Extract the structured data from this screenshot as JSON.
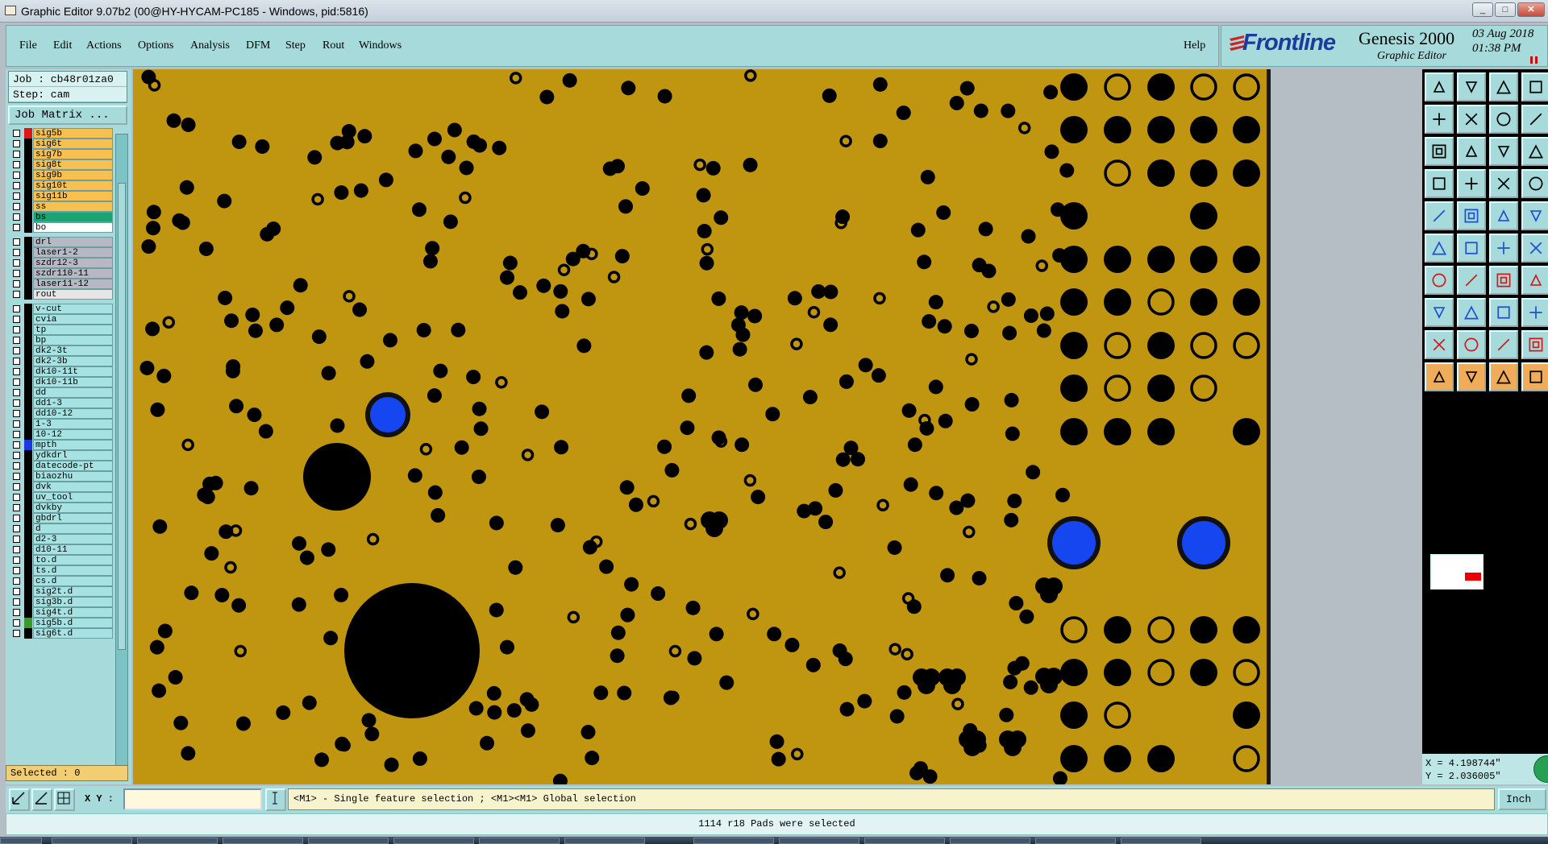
{
  "window": {
    "title": "Graphic Editor 9.07b2 (00@HY-HYCAM-PC185 - Windows, pid:5816)",
    "controls": [
      "_",
      "□",
      "✕"
    ]
  },
  "menu": [
    "File",
    "Edit",
    "Actions",
    "Options",
    "Analysis",
    "DFM",
    "Step",
    "Rout",
    "Windows"
  ],
  "help_label": "Help",
  "brand": {
    "logo": "Frontline",
    "product": "Genesis 2000",
    "subtitle": "Graphic Editor",
    "date": "03 Aug 2018",
    "time": "01:38 PM",
    "accent_color": "#1c3b9c",
    "menu_bg": "#a7dadb"
  },
  "job": {
    "job_line": "Job  : cb48r01za0",
    "step_line": "Step: cam",
    "matrix_button": "Job Matrix ..."
  },
  "layers": [
    {
      "name": "sig5b",
      "color": "#f7c04f",
      "swatch": "#e01515"
    },
    {
      "name": "sig6t",
      "color": "#f7c04f"
    },
    {
      "name": "sig7b",
      "color": "#f7c04f"
    },
    {
      "name": "sig8t",
      "color": "#f7c04f"
    },
    {
      "name": "sig9b",
      "color": "#f7c04f"
    },
    {
      "name": "sig10t",
      "color": "#f7c04f"
    },
    {
      "name": "sig11b",
      "color": "#f7c04f"
    },
    {
      "name": "ss",
      "color": "#f7c04f"
    },
    {
      "name": "bs",
      "color": "#1aa373"
    },
    {
      "name": "bo",
      "color": "#ffffff",
      "tag": "✎"
    },
    {
      "name": "drl",
      "color": "#b8b8c4",
      "gap": true
    },
    {
      "name": "laser1-2",
      "color": "#b8b8c4"
    },
    {
      "name": "szdr12-3",
      "color": "#b8b8c4"
    },
    {
      "name": "szdr110-11",
      "color": "#b8b8c4"
    },
    {
      "name": "laser11-12",
      "color": "#b8b8c4"
    },
    {
      "name": "rout",
      "color": "#e6e6e6"
    },
    {
      "name": "v-cut",
      "color": "#a7e2e3",
      "gap": true
    },
    {
      "name": "cvia",
      "color": "#a7e2e3"
    },
    {
      "name": "tp",
      "color": "#a7e2e3"
    },
    {
      "name": "bp",
      "color": "#a7e2e3"
    },
    {
      "name": "dk2-3t",
      "color": "#a7e2e3"
    },
    {
      "name": "dk2-3b",
      "color": "#a7e2e3"
    },
    {
      "name": "dk10-11t",
      "color": "#a7e2e3"
    },
    {
      "name": "dk10-11b",
      "color": "#a7e2e3"
    },
    {
      "name": "dd",
      "color": "#a7e2e3"
    },
    {
      "name": "dd1-3",
      "color": "#a7e2e3"
    },
    {
      "name": "dd10-12",
      "color": "#a7e2e3"
    },
    {
      "name": "1-3",
      "color": "#a7e2e3"
    },
    {
      "name": "10-12",
      "color": "#a7e2e3"
    },
    {
      "name": "mpth",
      "color": "#a7e2e3",
      "swatch": "#1d37e0"
    },
    {
      "name": "ydkdrl",
      "color": "#a7e2e3"
    },
    {
      "name": "datecode-pt",
      "color": "#a7e2e3"
    },
    {
      "name": "biaozhu",
      "color": "#a7e2e3"
    },
    {
      "name": "dvk",
      "color": "#a7e2e3"
    },
    {
      "name": "uv_tool",
      "color": "#a7e2e3"
    },
    {
      "name": "dvkby",
      "color": "#a7e2e3"
    },
    {
      "name": "gbdrl",
      "color": "#a7e2e3"
    },
    {
      "name": "d",
      "color": "#a7e2e3"
    },
    {
      "name": "d2-3",
      "color": "#a7e2e3"
    },
    {
      "name": "d10-11",
      "color": "#a7e2e3"
    },
    {
      "name": "to.d",
      "color": "#a7e2e3",
      "tag": "✎"
    },
    {
      "name": "ts.d",
      "color": "#a7e2e3"
    },
    {
      "name": "cs.d",
      "color": "#a7e2e3"
    },
    {
      "name": "sig2t.d",
      "color": "#a7e2e3"
    },
    {
      "name": "sig3b.d",
      "color": "#a7e2e3"
    },
    {
      "name": "sig4t.d",
      "color": "#a7e2e3"
    },
    {
      "name": "sig5b.d",
      "color": "#a7e2e3",
      "swatch": "#3a9a2c",
      "tag": "▣"
    },
    {
      "name": "sig6t.d",
      "color": "#a7e2e3"
    }
  ],
  "selected_label": "Selected : 0",
  "canvas": {
    "background": "#c09611",
    "pad_color": "#000000",
    "highlight_color": "#1546f0"
  },
  "coords": {
    "x": "X = 4.198744\"",
    "y": "Y = 2.036005\""
  },
  "xy_label": "X Y :",
  "xy_value": "",
  "hint": "<M1> - Single feature selection ; <M1><M1> Global selection",
  "units": "Inch",
  "status": "1114 r18 Pads were selected",
  "tool_icons": [
    "move-up-icon",
    "move-down-icon",
    "home-icon",
    "layout-icon",
    "move-left-icon",
    "move-right-icon",
    "mirror-icon",
    "snap-icon",
    "zoom-fit-icon",
    "zoom-center-icon",
    "scale-1-2-icon",
    "help-icon",
    "measure-icon",
    "grid-icon",
    "net-icon",
    "net-alt-icon",
    "pad-add-icon",
    "line-add-icon",
    "surface-icon",
    "round-pad-icon",
    "node-edit-icon",
    "cut-icon",
    "connect-icon",
    "connect-alt-icon",
    "draw-line-icon",
    "draw-line-alt-icon",
    "arc-icon",
    "text-icon",
    "copy-icon",
    "minus-icon",
    "resize-icon",
    "transform-icon",
    "triangle-icon",
    "triangle-alt-icon",
    "triangle-alt2-icon",
    "triangle-alt3-icon",
    "select-arrow-icon",
    "select-arrow-alt-icon",
    "select-arrow-alt2-icon",
    "select-ortho-icon"
  ]
}
